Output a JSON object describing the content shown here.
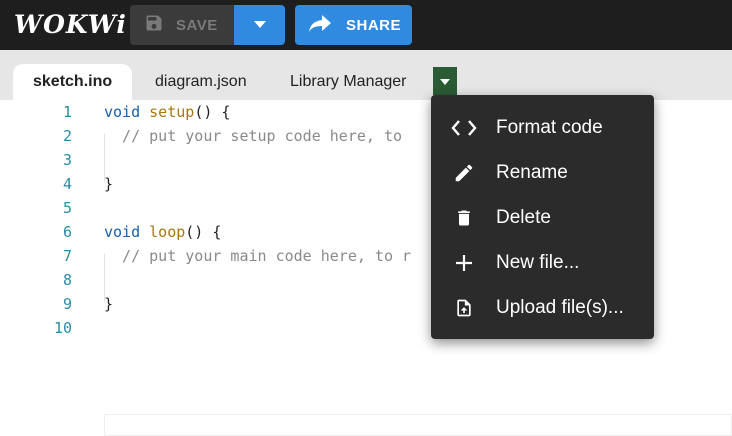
{
  "app": {
    "logo_text": "WOKWi"
  },
  "toolbar": {
    "save_label": "SAVE",
    "share_label": "SHARE"
  },
  "tabs": [
    {
      "label": "sketch.ino",
      "active": true
    },
    {
      "label": "diagram.json",
      "active": false
    },
    {
      "label": "Library Manager",
      "active": false
    }
  ],
  "editor": {
    "line_numbers": [
      "1",
      "2",
      "3",
      "4",
      "5",
      "6",
      "7",
      "8",
      "9",
      "10"
    ],
    "lines": [
      [
        {
          "t": "void",
          "c": "kw"
        },
        {
          "t": " ",
          "c": "pl"
        },
        {
          "t": "setup",
          "c": "fn"
        },
        {
          "t": "() {",
          "c": "pl"
        }
      ],
      [
        {
          "t": "  // put your setup code here, to ",
          "c": "cm"
        }
      ],
      [],
      [
        {
          "t": "}",
          "c": "pl"
        }
      ],
      [],
      [
        {
          "t": "void",
          "c": "kw"
        },
        {
          "t": " ",
          "c": "pl"
        },
        {
          "t": "loop",
          "c": "fn"
        },
        {
          "t": "() {",
          "c": "pl"
        }
      ],
      [
        {
          "t": "  // put your main code here, to r",
          "c": "cm"
        }
      ],
      [],
      [
        {
          "t": "}",
          "c": "pl"
        }
      ],
      []
    ]
  },
  "context_menu": {
    "items": [
      {
        "label": "Format code",
        "icon": "code-brackets-icon"
      },
      {
        "label": "Rename",
        "icon": "pencil-icon"
      },
      {
        "label": "Delete",
        "icon": "trash-icon"
      },
      {
        "label": "New file...",
        "icon": "plus-icon"
      },
      {
        "label": "Upload file(s)...",
        "icon": "upload-file-icon"
      }
    ]
  },
  "colors": {
    "accent": "#2f8ae0",
    "topbar": "#1e1e1e",
    "tab_dropdown": "#2a5b32",
    "menu_bg": "#2b2b2b"
  }
}
